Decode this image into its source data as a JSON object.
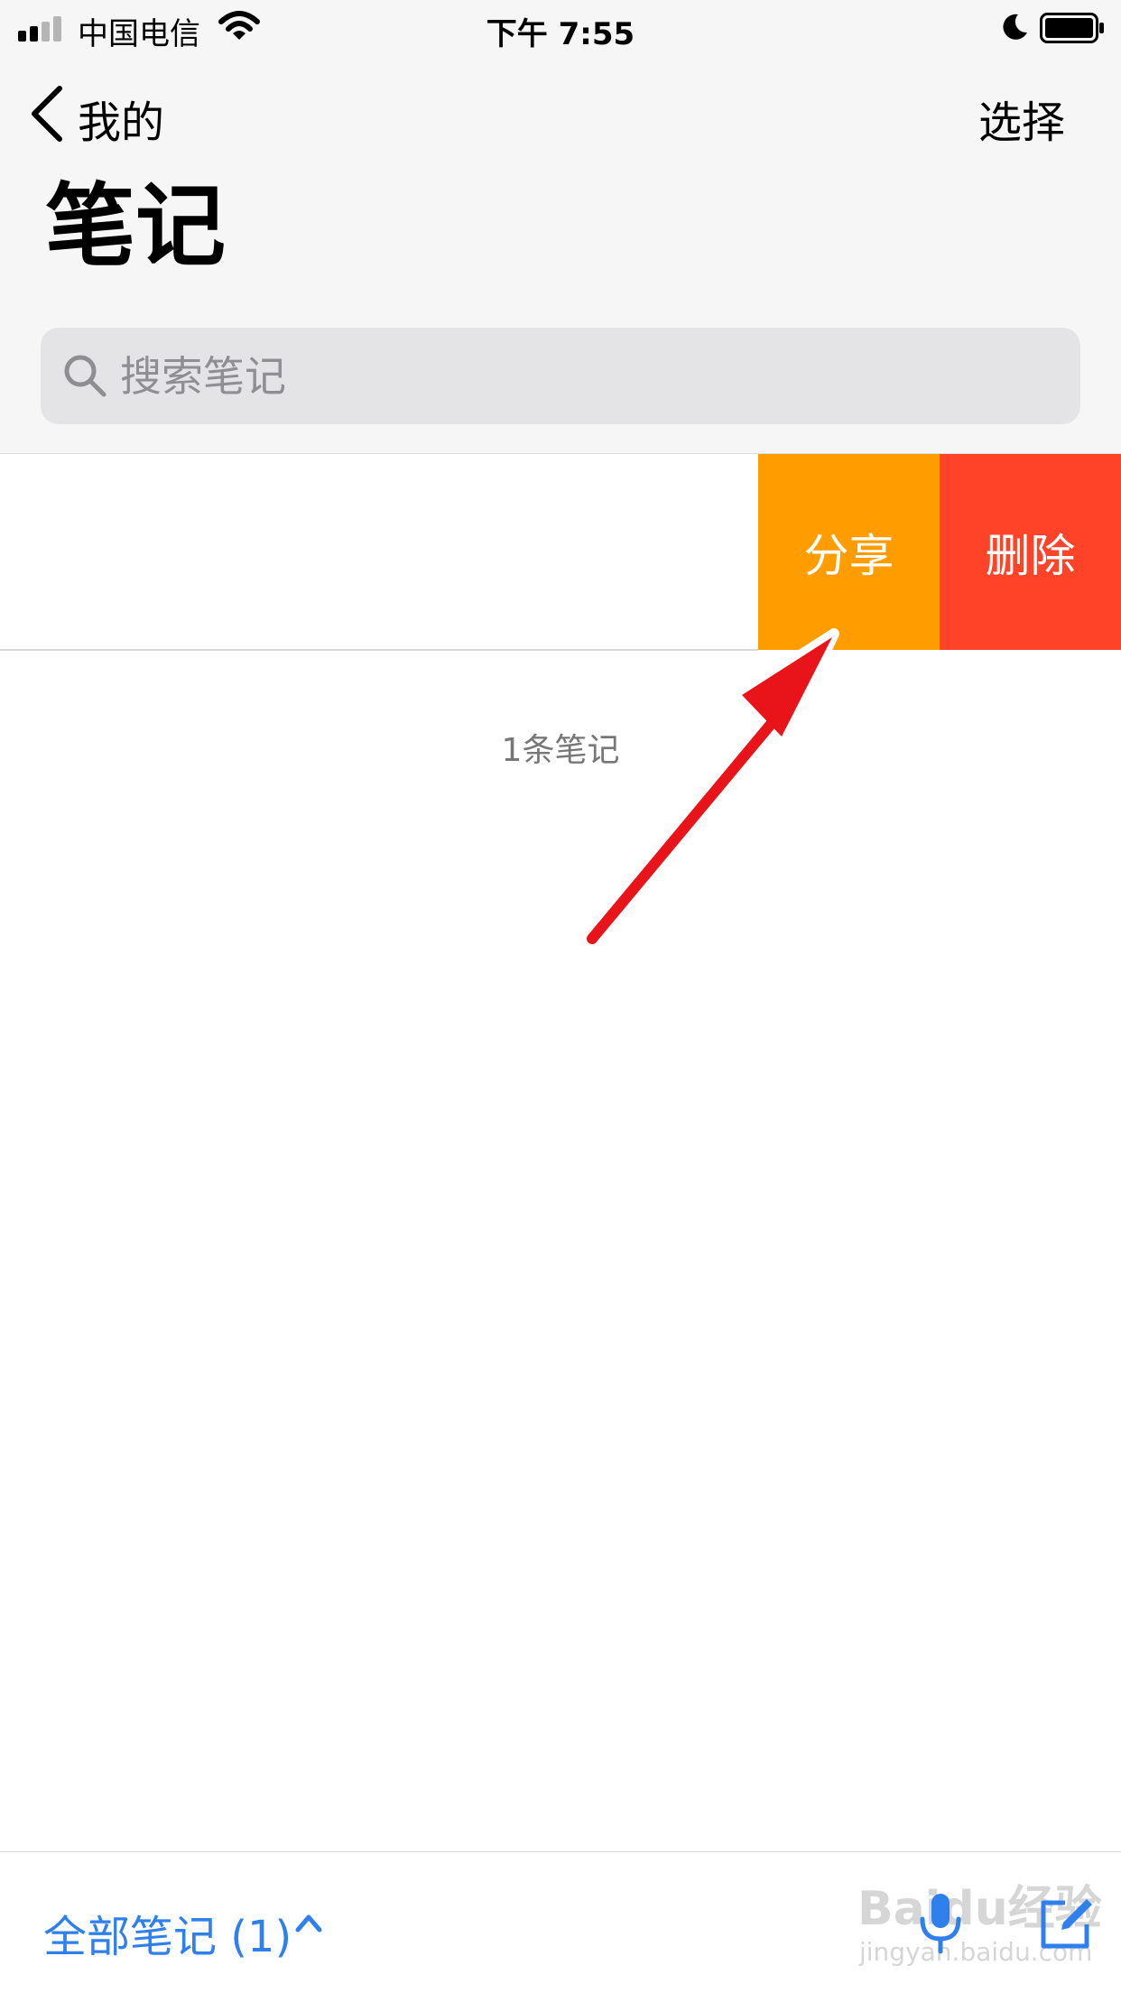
{
  "status_bar": {
    "carrier": "中国电信",
    "time": "下午 7:55"
  },
  "nav": {
    "back_label": "我的",
    "select_label": "选择"
  },
  "page": {
    "title": "笔记"
  },
  "search": {
    "placeholder": "搜索笔记"
  },
  "note_row": {
    "share_label": "分享",
    "delete_label": "删除"
  },
  "note_count": "1条笔记",
  "toolbar": {
    "folder_label": "全部笔记 (1)"
  },
  "watermark": {
    "text": "Baidu经验",
    "url": "jingyan.baidu.com"
  },
  "colors": {
    "share": "#ff9d00",
    "delete": "#ff4328",
    "accent": "#2f80ed",
    "arrow": "#e8141a"
  },
  "icons": [
    "signal-icon",
    "wifi-icon",
    "moon-icon",
    "battery-icon",
    "back-chevron-icon",
    "search-icon",
    "chevron-up-icon",
    "mic-icon",
    "compose-icon"
  ]
}
